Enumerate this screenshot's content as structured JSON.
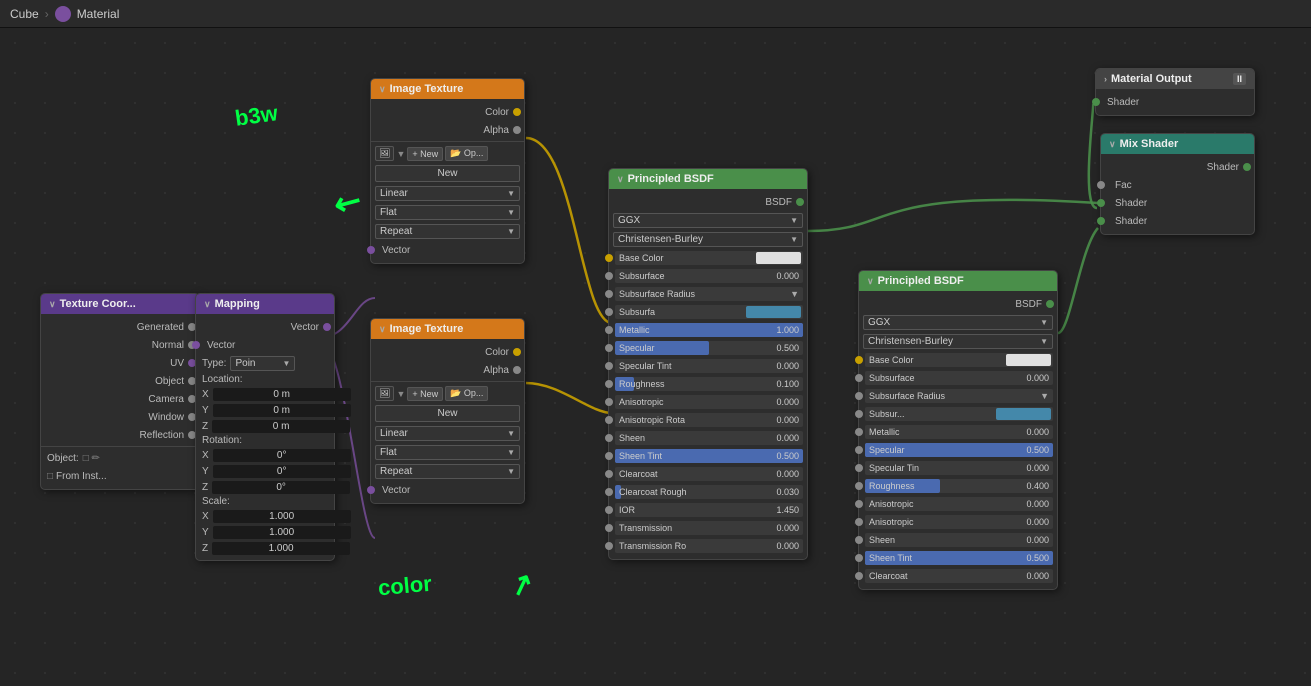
{
  "header": {
    "breadcrumb1": "Cube",
    "breadcrumb2": "Material"
  },
  "nodes": {
    "textureCoord": {
      "title": "Texture Coor...",
      "outputs": [
        "Generated",
        "Normal",
        "UV",
        "Object",
        "Camera",
        "Window",
        "Reflection"
      ],
      "object_label": "Object:",
      "from_inst": "From Inst..."
    },
    "mapping": {
      "title": "Mapping",
      "input_label": "Vector",
      "type_label": "Type:",
      "type_value": "Poin",
      "vector_label": "Vector",
      "location_label": "Location:",
      "rotation_label": "Rotation:",
      "scale_label": "Scale:",
      "x_loc": "0 m",
      "y_loc": "0 m",
      "z_loc": "0 m",
      "x_rot": "0°",
      "y_rot": "0°",
      "z_rot": "0°",
      "x_scale": "1.000",
      "y_scale": "1.000",
      "z_scale": "1.000"
    },
    "imageTexture1": {
      "title": "Image Texture",
      "color_label": "Color",
      "alpha_label": "Alpha",
      "new_btn": "+ New",
      "linear": "Linear",
      "flat": "Flat",
      "repeat": "Repeat",
      "vector_label": "Vector"
    },
    "imageTexture2": {
      "title": "Image Texture",
      "color_label": "Color",
      "alpha_label": "Alpha",
      "new_btn": "+ New",
      "linear": "Linear",
      "flat": "Flat",
      "repeat": "Repeat",
      "vector_label": "Vector"
    },
    "principledBSDF1": {
      "title": "Principled BSDF",
      "bsdf_label": "BSDF",
      "ggx": "GGX",
      "christensen": "Christensen-Burley",
      "base_color": "Base Color",
      "subsurface": "Subsurface",
      "subsurface_val": "0.000",
      "subsurface_radius": "Subsurface Radius",
      "subsurfa": "Subsurfa",
      "metallic": "Metallic",
      "metallic_val": "1.000",
      "specular": "Specular",
      "specular_val": "0.500",
      "specular_tint": "Specular Tint",
      "specular_tint_val": "0.000",
      "roughness": "Roughness",
      "roughness_val": "0.100",
      "anisotropic": "Anisotropic",
      "anisotropic_val": "0.000",
      "anisotropic_rota": "Anisotropic Rota",
      "anisotropic_rota_val": "0.000",
      "sheen": "Sheen",
      "sheen_val": "0.000",
      "sheen_tint": "Sheen Tint",
      "sheen_tint_val": "0.500",
      "clearcoat": "Clearcoat",
      "clearcoat_val": "0.000",
      "clearcoat_rough": "Clearcoat Rough",
      "clearcoat_rough_val": "0.030",
      "ior": "IOR",
      "ior_val": "1.450",
      "transmission": "Transmission",
      "transmission_val": "0.000",
      "transmission_ro": "Transmission Ro",
      "transmission_ro_val": "0.000"
    },
    "principledBSDF2": {
      "title": "Principled BSDF",
      "bsdf_label": "BSDF",
      "ggx": "GGX",
      "christensen": "Christensen-Burley",
      "base_color": "Base Color",
      "subsurface": "Subsurface",
      "subsurface_val": "0.000",
      "subsurface_radius": "Subsurface Radius",
      "subsur": "Subsur...",
      "metallic": "Metallic",
      "metallic_val": "0.000",
      "specular": "Specular",
      "specular_val": "0.500",
      "specular_tint": "Specular Tin",
      "specular_tint_val": "0.000",
      "roughness": "Roughness",
      "roughness_val": "0.400",
      "anisotropic": "Anisotropic",
      "anisotropic_val": "0.000",
      "anisotropic2": "Anisotropic",
      "anisotropic2_val": "0.000",
      "sheen": "Sheen",
      "sheen_val": "0.000",
      "sheen_tint": "Sheen Tint",
      "sheen_tint_val": "0.500",
      "clearcoat": "Clearcoat",
      "clearcoat_val": "0.000"
    },
    "mixShader": {
      "title": "Mix Shader",
      "fac_label": "Fac",
      "shader1_label": "Shader",
      "shader2_label": "Shader",
      "shader_out": "Shader"
    },
    "materialOutput": {
      "title": "Material Output",
      "shader_label": "Shader"
    }
  },
  "annotations": {
    "bsw": "b3w",
    "arrow_text": "↓",
    "color_text": "color"
  }
}
